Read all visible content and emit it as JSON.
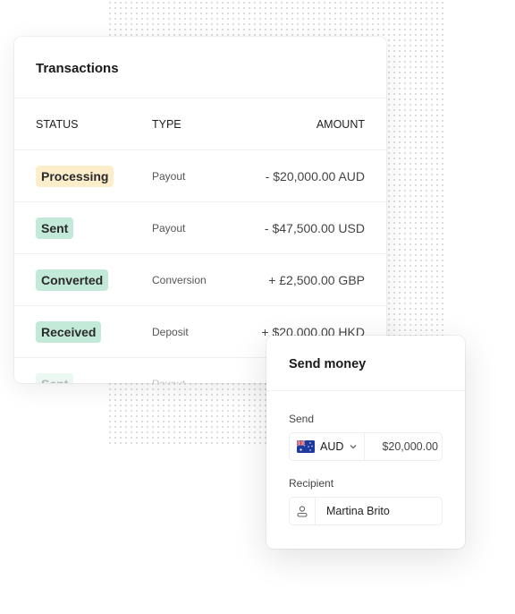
{
  "transactions": {
    "title": "Transactions",
    "columns": [
      "STATUS",
      "TYPE",
      "AMOUNT"
    ],
    "rows": [
      {
        "status": "Processing",
        "type": "Payout",
        "amount": "- $20,000.00 AUD",
        "badge_color": "#fdeecb"
      },
      {
        "status": "Sent",
        "type": "Payout",
        "amount": "- $47,500.00 USD",
        "badge_color": "#c3ead9"
      },
      {
        "status": "Converted",
        "type": "Conversion",
        "amount": "+  £2,500.00 GBP",
        "badge_color": "#c3ead9"
      },
      {
        "status": "Received",
        "type": "Deposit",
        "amount": "+ $20,000.00 HKD",
        "badge_color": "#c3ead9"
      },
      {
        "status": "Sent",
        "type": "Payout",
        "amount": "",
        "badge_color": "#c3ead9"
      }
    ]
  },
  "send_money": {
    "title": "Send money",
    "send_label": "Send",
    "currency": "AUD",
    "currency_icon": "australia-flag-icon",
    "amount": "$20,000.00",
    "recipient_label": "Recipient",
    "recipient_icon": "person-icon",
    "recipient": "Martina Brito"
  }
}
